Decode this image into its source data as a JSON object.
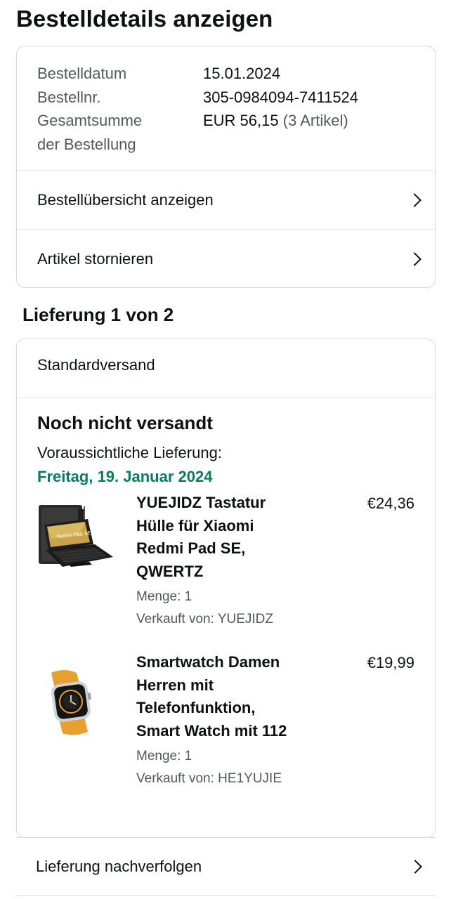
{
  "page": {
    "title": "Bestelldetails anzeigen"
  },
  "order": {
    "date_label": "Bestelldatum",
    "date_value": "15.01.2024",
    "number_label": "Bestellnr.",
    "number_value": "305-0984094-7411524",
    "total_label_line1": "Gesamtsumme",
    "total_label_line2": "der Bestellung",
    "total_value": "EUR 56,15",
    "total_count": "(3 Artikel)"
  },
  "actions": {
    "summary_label": "Bestellübersicht anzeigen",
    "cancel_label": "Artikel stornieren",
    "track_label": "Lieferung nachverfolgen"
  },
  "delivery": {
    "heading": "Lieferung 1 von 2",
    "shipping_method": "Standardversand",
    "status": "Noch nicht versandt",
    "estimate_label": "Voraussichtliche Lieferung:",
    "estimate_date": "Freitag, 19. Januar 2024",
    "estimate_color": "#067d62",
    "items": [
      {
        "title_lines": [
          "YUEJIDZ Tastatur",
          "Hülle für Xiaomi",
          "Redmi Pad SE,",
          "QWERTZ"
        ],
        "price": "€24,36",
        "quantity": "Menge: 1",
        "seller": "Verkauft von: YUEJIDZ",
        "image_icon": "tablet-keyboard-case-image",
        "image_text": "Redmi Pad SE"
      },
      {
        "title_lines": [
          "Smartwatch Damen",
          "Herren mit",
          "Telefonfunktion,",
          "Smart Watch mit 112"
        ],
        "price": "€19,99",
        "quantity": "Menge: 1",
        "seller": "Verkauft von: HE1YUJIE",
        "image_icon": "smartwatch-image"
      }
    ]
  },
  "icons": {
    "chevron": "chevron-right-icon"
  }
}
